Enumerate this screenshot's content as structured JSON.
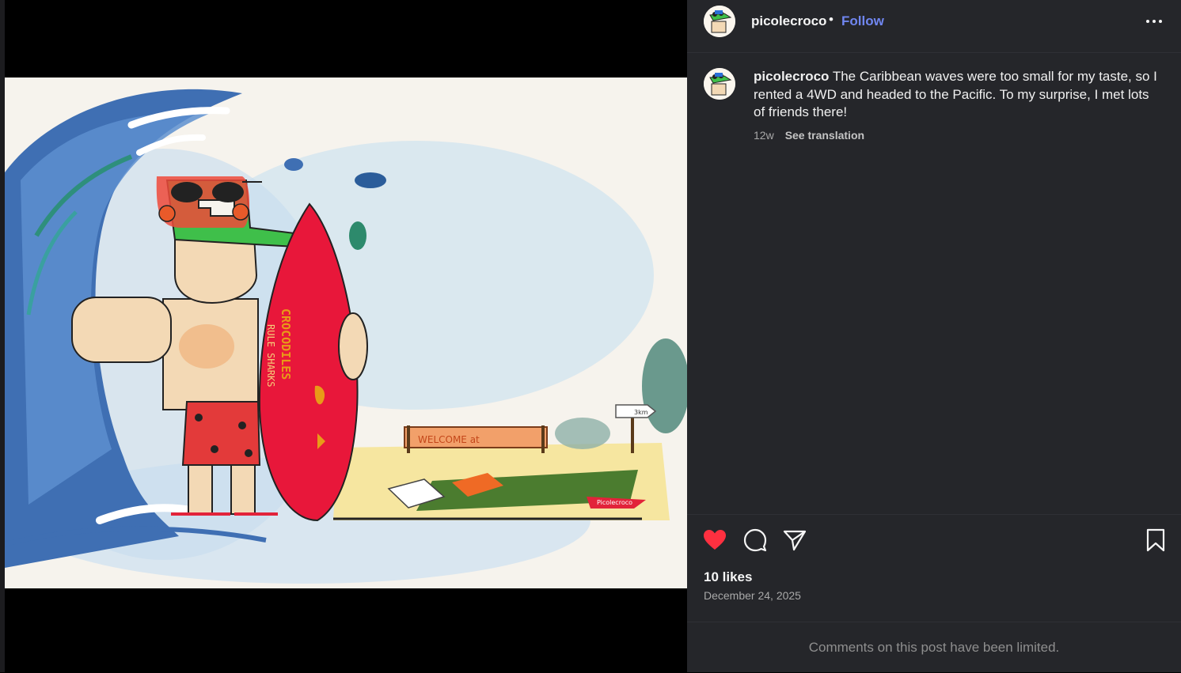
{
  "post": {
    "username": "picolecroco",
    "follow_label": "Follow",
    "separator": "•",
    "caption": "The Caribbean waves were too small for my taste, so I rented a 4WD and headed to the Pacific. To my surprise, I met lots of friends there!",
    "age": "12w",
    "see_translation": "See translation",
    "likes": "10 likes",
    "date": "December 24, 2025",
    "comments_limited": "Comments on this post have been limited."
  },
  "artwork": {
    "board_text_1": "CROCODILES",
    "board_text_2": "RULE SHARKS",
    "sign_text": "WELCOME at",
    "arrow_sign": "3km",
    "towel_text": "Picolecroco"
  },
  "icons": {
    "like": "heart-filled-icon",
    "comment": "speech-bubble-icon",
    "share": "paper-plane-icon",
    "save": "bookmark-icon",
    "more": "ellipsis-icon"
  },
  "colors": {
    "panel_bg": "#25262a",
    "follow": "#7086f0",
    "like_red": "#ff3040",
    "muted_text": "#a8a8a8"
  }
}
